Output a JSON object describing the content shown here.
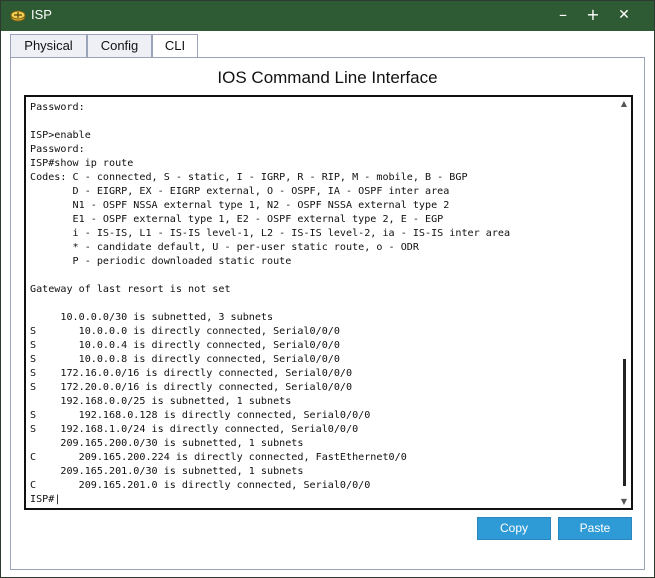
{
  "window": {
    "title": "ISP",
    "minimize": "–",
    "maximize": "+",
    "close": "✕"
  },
  "tabs": [
    {
      "label": "Physical"
    },
    {
      "label": "Config"
    },
    {
      "label": "CLI"
    }
  ],
  "heading": "IOS Command Line Interface",
  "terminal": {
    "lines": [
      "Password:",
      "",
      "ISP>enable",
      "Password:",
      "ISP#show ip route",
      "Codes: C - connected, S - static, I - IGRP, R - RIP, M - mobile, B - BGP",
      "       D - EIGRP, EX - EIGRP external, O - OSPF, IA - OSPF inter area",
      "       N1 - OSPF NSSA external type 1, N2 - OSPF NSSA external type 2",
      "       E1 - OSPF external type 1, E2 - OSPF external type 2, E - EGP",
      "       i - IS-IS, L1 - IS-IS level-1, L2 - IS-IS level-2, ia - IS-IS inter area",
      "       * - candidate default, U - per-user static route, o - ODR",
      "       P - periodic downloaded static route",
      "",
      "Gateway of last resort is not set",
      "",
      "     10.0.0.0/30 is subnetted, 3 subnets",
      "S       10.0.0.0 is directly connected, Serial0/0/0",
      "S       10.0.0.4 is directly connected, Serial0/0/0",
      "S       10.0.0.8 is directly connected, Serial0/0/0",
      "S    172.16.0.0/16 is directly connected, Serial0/0/0",
      "S    172.20.0.0/16 is directly connected, Serial0/0/0",
      "     192.168.0.0/25 is subnetted, 1 subnets",
      "S       192.168.0.128 is directly connected, Serial0/0/0",
      "S    192.168.1.0/24 is directly connected, Serial0/0/0",
      "     209.165.200.0/30 is subnetted, 1 subnets",
      "C       209.165.200.224 is directly connected, FastEthernet0/0",
      "     209.165.201.0/30 is subnetted, 1 subnets",
      "C       209.165.201.0 is directly connected, Serial0/0/0",
      "ISP#"
    ]
  },
  "buttons": {
    "copy": "Copy",
    "paste": "Paste"
  }
}
